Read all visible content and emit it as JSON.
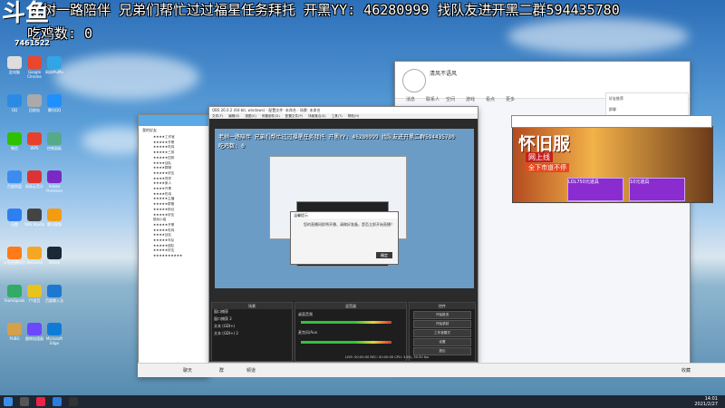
{
  "overlay": {
    "line1": "老树一路陪伴  兄弟们帮忙过过福星任务拜托  开黑YY: 46280999  找队友进开黑二群594435780",
    "line2": "吃鸡数: 0"
  },
  "logo": {
    "text": "斗鱼",
    "sub": "7461522"
  },
  "desktop_icons": [
    "此电脑",
    "Google Chrome",
    "网易MuMu",
    "QQ",
    "回收站",
    "腾讯QQ",
    "微信",
    "WPS",
    "控制面板",
    "百度网盘",
    "网易云音乐",
    "Adobe Premiere",
    "迅雷",
    "OBS Studio",
    "腾讯视频",
    "斗鱼直播伴侣",
    "WeGame",
    "Steam",
    "TeamSpeak",
    "YY语音",
    "百度输入法",
    "PUBG",
    "雷神加速器",
    "Microsoft Edge"
  ],
  "qq_main": {
    "nickname": "清风不语风",
    "tabs": [
      "消息",
      "联系人",
      "空间",
      "游戏",
      "看点",
      "更多"
    ],
    "panel_items": [
      "好友推荐",
      "群聊",
      "频道"
    ]
  },
  "contacts": {
    "header": "我的好友",
    "items": [
      "★★★★工作室",
      "★★★★★开黑",
      "★★★★★吃鸡",
      "★★★★★三排",
      "★★★★★四排",
      "★★★★战队",
      "★★★★群聊",
      "★★★★★好友",
      "★★★★同学",
      "★★★★家人",
      "★★★★开黑",
      "★★★★吃鸡",
      "★★★★★主播",
      "★★★★★群管",
      "★★★★★粉丝",
      "★★★★★好友",
      "陪玩小组",
      "★★★★★开黑",
      "★★★★★吃鸡",
      "★★★★战友",
      "★★★★★车队",
      "★★★★★团队",
      "★★★★★好友",
      "★★★★★★★★★★"
    ]
  },
  "banner": {
    "title": "怀旧服",
    "badge1": "网上线",
    "badge2": "全下市道不停",
    "shop": [
      "LOL750元道具",
      "10元道具"
    ]
  },
  "obs": {
    "title": "OBS 26.0.2 (64-bit, windows) - 配置文件: 未命名 - 场景: 未命名",
    "menu": [
      "文件(F)",
      "编辑(E)",
      "视图(V)",
      "停靠部件(D)",
      "配置文件(P)",
      "场景集合(S)",
      "工具(T)",
      "帮助(H)"
    ],
    "panels": {
      "scenes": "场景",
      "sources": "来源",
      "mixer": "混音器",
      "controls": "控件"
    },
    "sources": [
      "窗口捕获",
      "窗口捕获 2",
      "文本 (GDI+)",
      "文本 (GDI+) 2"
    ],
    "mixer": [
      "桌面音频",
      "麦克风/Aux"
    ],
    "controls": [
      "开始推流",
      "开始录制",
      "工作室模式",
      "设置",
      "退出"
    ],
    "status": "LIVE: 00:00:00   REC: 00:00:00   CPU: 3.6%, 30.00 fps"
  },
  "dialog": {
    "title": "温馨提示",
    "message": "您的直播间即将开播，请做好准备，是否立即开始直播？",
    "ok": "确定"
  },
  "qq_bar": {
    "items": [
      "聊天",
      "群",
      "频道",
      "收藏"
    ]
  },
  "clock": {
    "time": "14:01",
    "date": "2021/2/27"
  }
}
